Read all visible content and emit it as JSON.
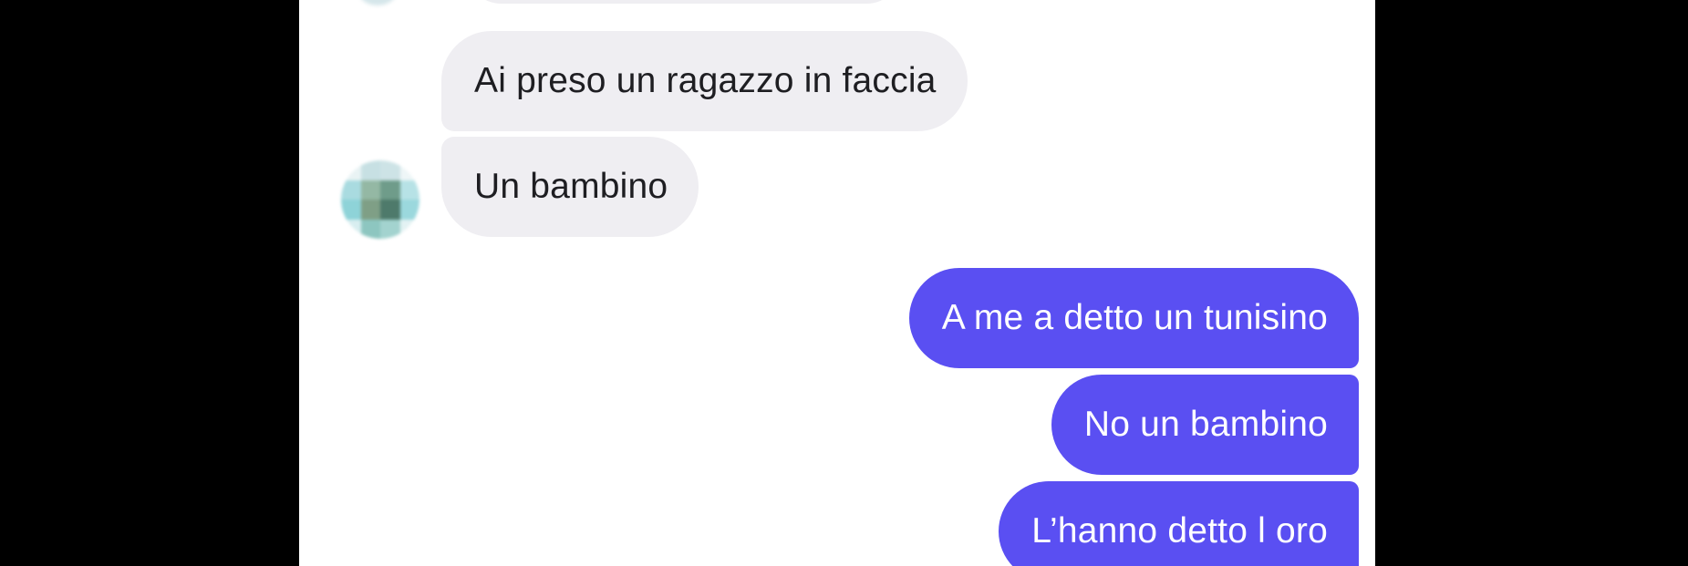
{
  "chat": {
    "messages": [
      {
        "direction": "incoming",
        "text": "Ai preso un ragazzo in faccia"
      },
      {
        "direction": "incoming",
        "text": "Un bambino"
      },
      {
        "direction": "outgoing",
        "text": "A me a detto un tunisino"
      },
      {
        "direction": "outgoing",
        "text": "No un bambino"
      },
      {
        "direction": "outgoing",
        "text": "L’hanno detto l oro"
      }
    ]
  },
  "colors": {
    "background": "#000000",
    "panel": "#ffffff",
    "incoming_bubble": "#efeef2",
    "incoming_text": "#1e1e22",
    "outgoing_bubble": "#5a4ff2",
    "outgoing_text": "#ffffff"
  },
  "icons": {
    "contact_avatar": "pixelated-avatar-icon"
  }
}
